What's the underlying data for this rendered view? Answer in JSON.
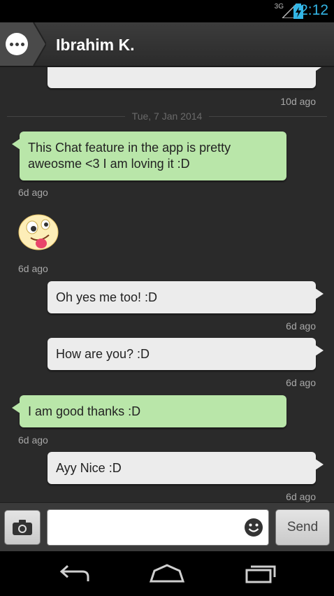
{
  "status_bar": {
    "network": "3G",
    "time": "2:12",
    "time_color": "#33b5e5"
  },
  "header": {
    "title": "Ibrahim K.",
    "menu_icon": "more-dots-icon"
  },
  "chat": {
    "messages": [
      {
        "direction": "out",
        "text": "",
        "time": "10d ago"
      },
      {
        "direction": "in",
        "text": "This Chat feature in the app is pretty aweosme <3 I am loving it :D",
        "time": "6d ago"
      },
      {
        "direction": "in",
        "emoji": "tongue-out-face",
        "time": "6d ago"
      },
      {
        "direction": "out",
        "text": "Oh yes me too! :D",
        "time": "6d ago"
      },
      {
        "direction": "out",
        "text": "How are you? :D",
        "time": "6d ago"
      },
      {
        "direction": "in",
        "text": "I am good thanks :D",
        "time": "6d ago"
      },
      {
        "direction": "out",
        "text": "Ayy Nice :D",
        "time": "6d ago"
      }
    ],
    "date_divider": "Tue, 7 Jan 2014"
  },
  "composer": {
    "input_value": "",
    "send_label": "Send",
    "camera_icon": "camera-icon",
    "emoji_icon": "smiley-icon"
  },
  "colors": {
    "incoming_bubble": "#b9e6a9",
    "outgoing_bubble": "#ececec",
    "background": "#2a2a2a"
  }
}
